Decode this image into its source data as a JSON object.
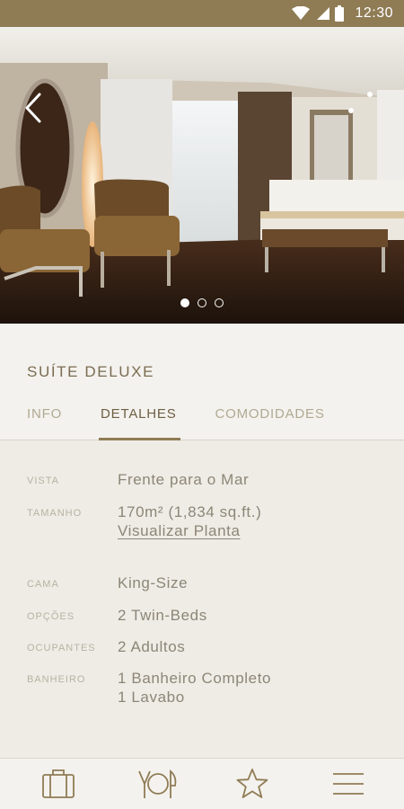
{
  "status_bar": {
    "time": "12:30"
  },
  "hero": {
    "slide_count": 3,
    "active_slide": 1
  },
  "room": {
    "title": "SUÍTE DELUXE"
  },
  "tabs": [
    {
      "label": "INFO",
      "active": false
    },
    {
      "label": "DETALHES",
      "active": true
    },
    {
      "label": "COMODIDADES",
      "active": false
    }
  ],
  "details": {
    "vista": {
      "label": "VISTA",
      "value": "Frente para o Mar"
    },
    "tamanho": {
      "label": "TAMANHO",
      "value": "170m² (1,834 sq.ft.)",
      "link": "Visualizar Planta"
    },
    "cama": {
      "label": "CAMA",
      "value": "King-Size"
    },
    "opcoes": {
      "label": "OPÇÕES",
      "value": "2 Twin-Beds"
    },
    "ocupantes": {
      "label": "OCUPANTES",
      "value": "2 Adultos"
    },
    "banheiro": {
      "label": "BANHEIRO",
      "value_1": "1 Banheiro Completo",
      "value_2": "1 Lavabo"
    }
  },
  "bottom_nav": [
    "suitcase-icon",
    "dining-icon",
    "star-icon",
    "menu-icon"
  ],
  "colors": {
    "accent": "#8f7c55",
    "status_bar": "#8f7c55",
    "text_dark": "#6d5f43",
    "text_muted": "#b0a992"
  }
}
